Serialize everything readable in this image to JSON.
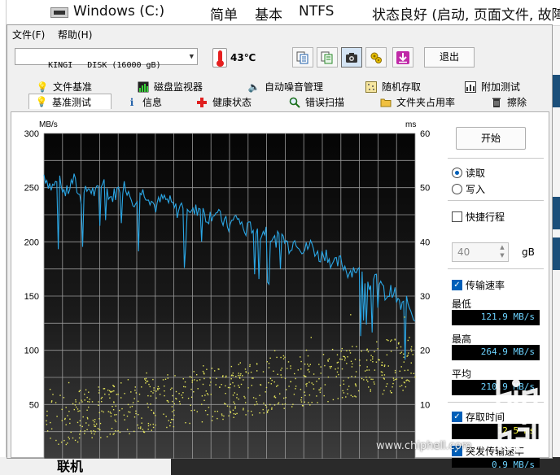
{
  "background": {
    "explorer": {
      "drive_label": "Windows (C:)",
      "col_type": "简单",
      "col_layout": "基本",
      "col_fs": "NTFS",
      "col_status": "状态良好 (启动, 页面文件, 故障"
    },
    "bottom_text": "联机"
  },
  "menubar": {
    "items": [
      {
        "label": "文件(F)"
      },
      {
        "label": "帮助(H)"
      }
    ]
  },
  "toolbar": {
    "drive_select": "KINGI   DISK (16000 gB)",
    "temperature": "43℃",
    "exit_label": "退出",
    "buttons": [
      {
        "icon": "copy-text-icon"
      },
      {
        "icon": "copy-info-icon"
      },
      {
        "icon": "camera-icon"
      },
      {
        "icon": "options-icon"
      },
      {
        "icon": "download-icon"
      }
    ]
  },
  "tabs": {
    "row1": [
      {
        "label": "文件基准",
        "icon": "file-benchmark-icon"
      },
      {
        "label": "磁盘监视器",
        "icon": "disk-monitor-icon"
      },
      {
        "label": "自动噪音管理",
        "icon": "speaker-icon"
      },
      {
        "label": "随机存取",
        "icon": "random-access-icon"
      },
      {
        "label": "附加测试",
        "icon": "extra-tests-icon"
      }
    ],
    "row2": [
      {
        "label": "基准测试",
        "icon": "lightbulb-icon"
      },
      {
        "label": "信息",
        "icon": "info-icon"
      },
      {
        "label": "健康状态",
        "icon": "health-cross-icon"
      },
      {
        "label": "错误扫描",
        "icon": "magnifier-icon"
      },
      {
        "label": "文件夹占用率",
        "icon": "folder-icon"
      },
      {
        "label": "擦除",
        "icon": "trash-icon"
      }
    ]
  },
  "chart_data": {
    "type": "line",
    "left_axis_unit": "MB/s",
    "right_axis_unit": "ms",
    "ylim": [
      0,
      300
    ],
    "y2lim": [
      0,
      60
    ],
    "y_ticks": [
      50,
      100,
      150,
      200,
      250,
      300
    ],
    "y2_ticks": [
      10,
      20,
      30,
      40,
      50,
      60
    ],
    "grid": true,
    "series": [
      {
        "kind": "transfer-rate",
        "color": "#2ba7e6",
        "x": [
          0,
          2,
          4,
          6,
          8,
          10,
          12,
          14,
          16,
          18,
          20,
          22,
          24,
          26,
          28,
          30,
          32,
          34,
          36,
          38,
          40,
          42,
          44,
          46,
          48,
          50,
          52,
          54,
          56,
          58,
          60,
          62,
          64,
          66,
          68,
          70,
          72,
          74,
          76,
          78,
          80,
          82,
          84,
          86,
          88,
          90,
          92,
          94,
          96,
          98,
          100
        ],
        "values": [
          262,
          250,
          256,
          244,
          258,
          238,
          250,
          244,
          256,
          240,
          248,
          252,
          238,
          246,
          244,
          232,
          240,
          236,
          228,
          238,
          226,
          232,
          222,
          228,
          220,
          214,
          224,
          210,
          214,
          206,
          212,
          200,
          206,
          196,
          202,
          192,
          198,
          186,
          190,
          178,
          182,
          172,
          176,
          166,
          160,
          166,
          150,
          156,
          140,
          144,
          130
        ]
      },
      {
        "kind": "access-time",
        "color": "#e6e65a",
        "style": "scatter",
        "axis": "right",
        "trend_start": 7,
        "trend_end": 18
      }
    ]
  },
  "controls": {
    "start_label": "开始",
    "read_label": "读取",
    "write_label": "写入",
    "short_stroke_label": "快捷行程",
    "short_stroke_value": "40",
    "short_stroke_unit": "gB",
    "transfer_rate_label": "传输速率",
    "min_label": "最低",
    "min_value": "121.9 MB/s",
    "max_label": "最高",
    "max_value": "264.9 MB/s",
    "avg_label": "平均",
    "avg_value": "210.9 MB/s",
    "access_time_label": "存取时间",
    "access_time_value": "12.5 ms",
    "burst_label": "突发传输速率",
    "burst_value": "0.9 MB/s"
  },
  "watermark": {
    "site": "www.chiphell.com"
  }
}
